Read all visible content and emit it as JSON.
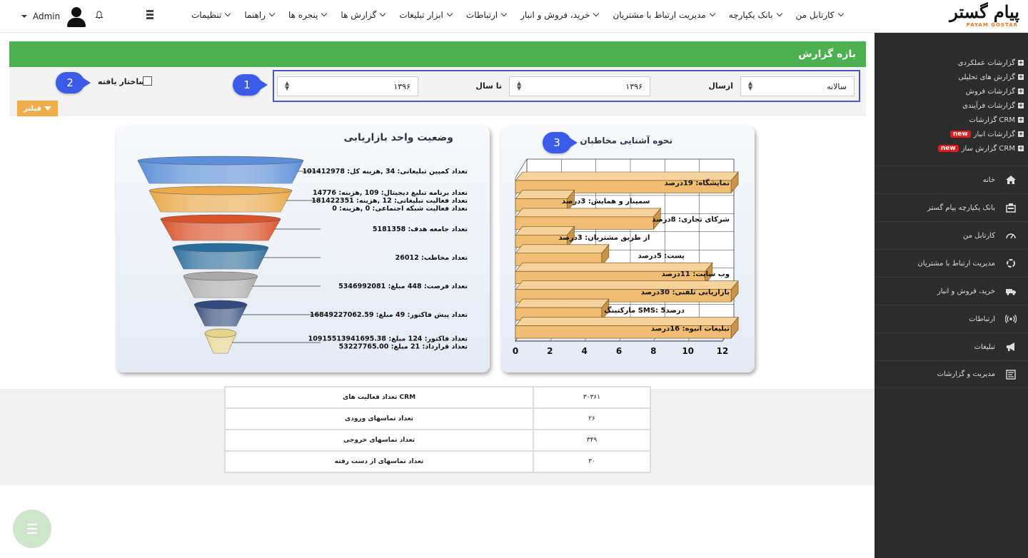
{
  "user": {
    "name": "Admin"
  },
  "brand": {
    "logo_text": "پیام گستر",
    "logo_sub": "PAYAM GOSTAR"
  },
  "nav": [
    "کارتابل من",
    "بانک یکپارچه",
    "مدیریت ارتباط با مشتریان",
    "خرید، فروش و انبار",
    "ارتباطات",
    "ابزار تبلیغات",
    "گزارش ها",
    "پنجره ها",
    "راهنما",
    "تنظیمات"
  ],
  "sidebar": {
    "reports": [
      {
        "label": "گزارشات عملکردی",
        "new": false
      },
      {
        "label": "گزارش های تحلیلی",
        "new": false
      },
      {
        "label": "گزارشات فروش",
        "new": false
      },
      {
        "label": "گزارشات فرآیندی",
        "new": false
      },
      {
        "label": "گزارشات CRM",
        "new": false
      },
      {
        "label": "گزارشات انبار",
        "new": true
      },
      {
        "label": "گزارش ساز CRM",
        "new": true
      }
    ],
    "new_label": "new",
    "menu": [
      {
        "label": "خانه",
        "icon": "home-icon"
      },
      {
        "label": "بانک یکپارچه پیام گستر",
        "icon": "bank-icon"
      },
      {
        "label": "کارتابل من",
        "icon": "dashboard-icon"
      },
      {
        "label": "مدیریت ارتباط با مشتریان",
        "icon": "crm-icon"
      },
      {
        "label": "خرید، فروش و انبار",
        "icon": "truck-icon"
      },
      {
        "label": "ارتباطات",
        "icon": "broadcast-icon"
      },
      {
        "label": "تبلیغات",
        "icon": "megaphone-icon"
      },
      {
        "label": "مدیریت و گزارشات",
        "icon": "report-icon"
      }
    ]
  },
  "report_range": {
    "title": "بازه گزارش",
    "period_value": "سالانه",
    "from_label": "ازسال",
    "from_value": "۱۳۹۶",
    "to_label": "تا سال",
    "to_value": "۱۳۹۶",
    "structured_label": "ساختار یافته",
    "filter_label": "فیلتر"
  },
  "callouts": [
    "1",
    "2",
    "3"
  ],
  "funnel": {
    "title": "وضعیت واحد بازاریابی",
    "levels": [
      {
        "lines": [
          "تعداد کمپین تبلیغاتی: 34 ,هزینه کل: 101412978"
        ],
        "color": "#5b8fd8"
      },
      {
        "lines": [
          "تعداد برنامه تبلیغ دیجیتال: 109 ,هزینه: 14776",
          "تعداد فعالیت تبلیغاتی: 12 ,هزینه: 181422351",
          "تعداد فعالیت شبکه اجتماعی: 0 ,هزینه: 0"
        ],
        "color": "#e9a84a"
      },
      {
        "lines": [
          "تعداد جامعه هدف: 5181358"
        ],
        "color": "#d9532a"
      },
      {
        "lines": [
          "تعداد مخاطب: 26012"
        ],
        "color": "#2b6d9a"
      },
      {
        "lines": [
          "تعداد فرصت: 448 مبلغ: 5346992081"
        ],
        "color": "#a9a9a9"
      },
      {
        "lines": [
          "تعداد پیش فاکتور: 49 مبلغ: 16849227062.59"
        ],
        "color": "#30497a"
      },
      {
        "lines": [
          "تعداد فاکتور: 124 مبلغ: 10915513941695.38",
          "تعداد قرارداد: 21 مبلغ: 53227765.00"
        ],
        "color": "#e6d48a"
      }
    ]
  },
  "chart_data": {
    "type": "bar",
    "title": "نحوه آشنایی مخاطبان",
    "orientation": "horizontal",
    "categories": [
      "نمایشگاه",
      "سمینار و همایش",
      "شرکای تجاری",
      "از طریق مشتریان",
      "پست",
      "وب سایت",
      "بازاریابی تلفنی",
      "مارکتینگ SMS",
      "تبلیغات انبوه"
    ],
    "values": [
      19,
      3,
      8,
      3,
      5,
      11,
      30,
      5,
      16
    ],
    "labels": [
      "نمایشگاه: 19درصد",
      "سمینار و همایش: 3درصد",
      "شرکای تجاری: 8درصد",
      "از طریق مشتریان: 3درصد",
      "پست: 5درصد",
      "وب سایت: 11درصد",
      "بازاریابی تلفنی: 30درصد",
      "مارکتینگ SMS: 5درصد",
      "تبلیغات انبوه: 16درصد"
    ],
    "xticks": [
      "0",
      "2",
      "4",
      "6",
      "8",
      "10",
      "12"
    ],
    "xlim": [
      0,
      12
    ],
    "grid": true,
    "color": "#f0bd72"
  },
  "stats": [
    {
      "label": "تعداد فعالیت های CRM",
      "value": "۳۰۳۶۱"
    },
    {
      "label": "تعداد تماسهای ورودی",
      "value": "۲۶"
    },
    {
      "label": "تعداد تماسهای خروجی",
      "value": "۳۴۹"
    },
    {
      "label": "تعداد تماسهای از دست رفته",
      "value": "۳۰"
    }
  ]
}
